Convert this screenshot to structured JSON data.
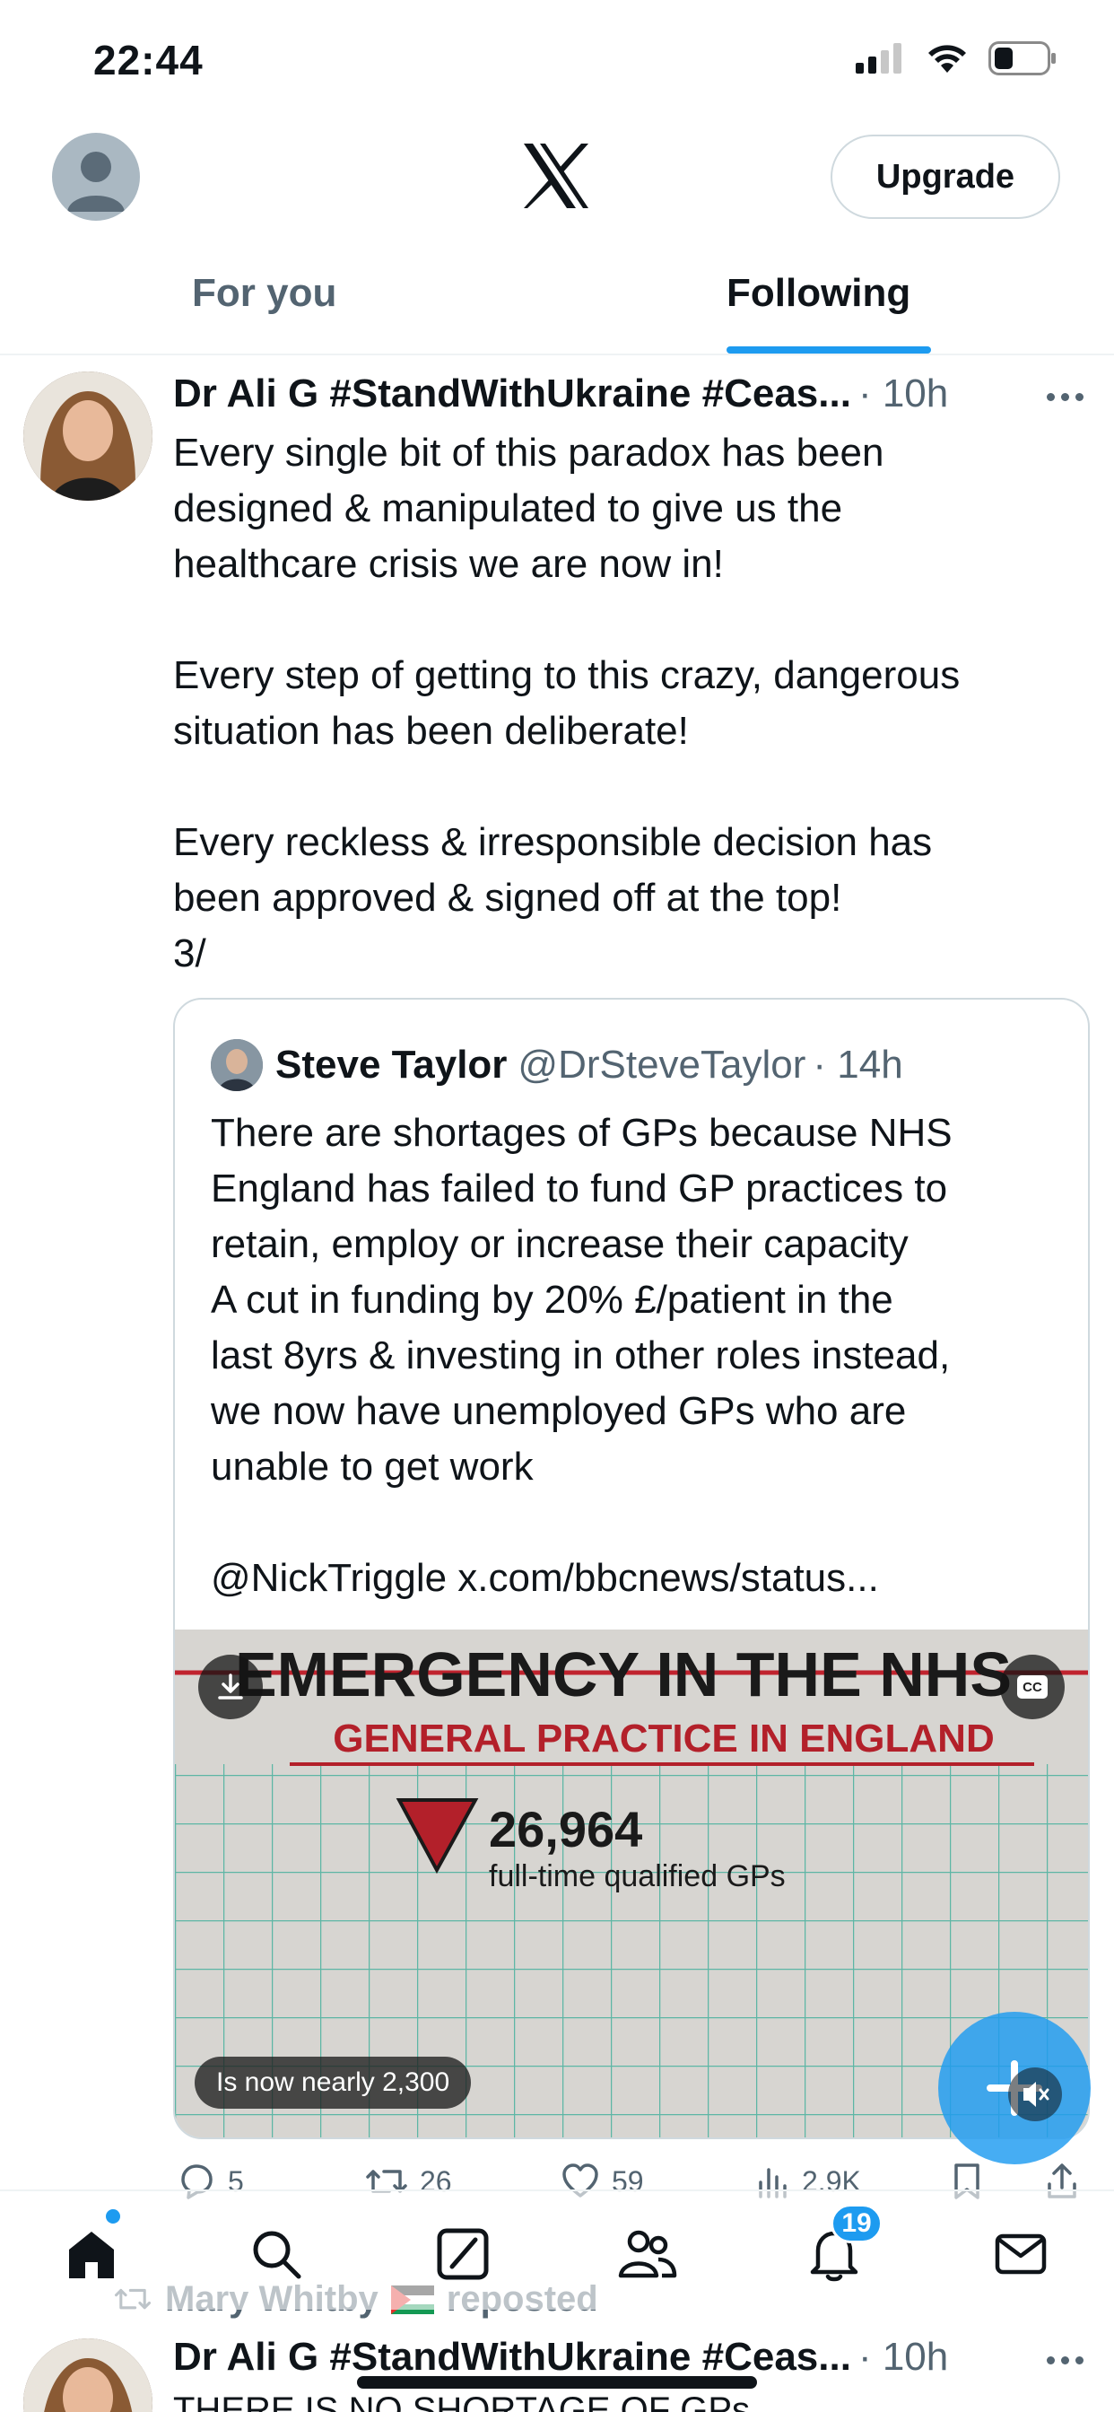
{
  "status_bar": {
    "time": "22:44"
  },
  "header": {
    "upgrade_label": "Upgrade",
    "logo": "x-logo"
  },
  "tabs": [
    {
      "label": "For you",
      "active": false
    },
    {
      "label": "Following",
      "active": true
    }
  ],
  "post": {
    "author_name": "Dr Ali G #StandWithUkraine #Ceas...",
    "time": "· 10h",
    "text": "Every single bit of this paradox has been\ndesigned & manipulated to give us the\nhealthcare crisis we are now in!\n\nEvery step of getting to this crazy, dangerous\nsituation has been deliberate!\n\nEvery reckless & irresponsible decision has\nbeen approved & signed off at the top!\n3/",
    "quote": {
      "name": "Steve Taylor",
      "handle": "@DrSteveTaylor",
      "time": "· 14h",
      "text": "There are shortages of GPs because NHS\nEngland has failed to fund GP practices to\nretain, employ or increase their capacity\nA cut in funding by 20% £/patient in the\nlast 8yrs & investing in other roles instead,\nwe now have unemployed GPs who are\nunable to get work\n\n@NickTriggle x.com/bbcnews/status...",
      "media": {
        "headline": "EMERGENCY IN THE NHS",
        "subheadline": "GENERAL PRACTICE IN ENGLAND",
        "stat_value": "26,964",
        "stat_label": "full-time qualified GPs",
        "caption": "Is now nearly 2,300",
        "cc_label": "CC"
      }
    },
    "actions": {
      "replies": "5",
      "reposts": "26",
      "likes": "59",
      "views": "2.9K"
    }
  },
  "bottom_nav": {
    "notifications_badge": "19",
    "items": [
      "home-icon",
      "search-icon",
      "grok-icon",
      "communities-icon",
      "notifications-icon",
      "messages-icon"
    ]
  },
  "next_post": {
    "reposted_by": "Mary Whitby",
    "reposted_label": "reposted",
    "author_name": "Dr Ali G #StandWithUkraine #Ceas...",
    "time": "· 10h",
    "text_preview": "THERE IS NO SHORTAGE OF GPs"
  },
  "colors": {
    "accent": "#1d9bf0",
    "muted": "#536471",
    "text": "#0f1419"
  }
}
